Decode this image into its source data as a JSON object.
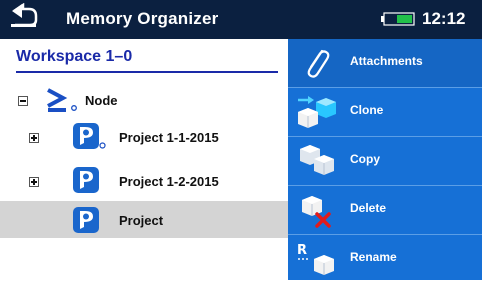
{
  "header": {
    "title": "Memory Organizer",
    "time": "12:12",
    "back_icon": "return-arrow-icon",
    "battery_icon": "battery-icon",
    "colors": {
      "bar": "#0b2040",
      "battery_fill": "#22c04a"
    }
  },
  "tree": {
    "workspace_label": "Workspace 1–0",
    "items": [
      {
        "label": "Node",
        "icon": "node-icon",
        "expander": "collapse"
      },
      {
        "label": "Project 1-1-2015",
        "icon": "project-icon",
        "expander": "expand"
      },
      {
        "label": "Project 1-2-2015",
        "icon": "project-icon",
        "expander": "expand"
      },
      {
        "label": "Project",
        "icon": "project-icon",
        "selected": true
      }
    ]
  },
  "actions": [
    {
      "label": "Attachments",
      "icon": "paperclip-icon"
    },
    {
      "label": "Clone",
      "icon": "clone-icon"
    },
    {
      "label": "Copy",
      "icon": "copy-icon"
    },
    {
      "label": "Delete",
      "icon": "delete-icon"
    },
    {
      "label": "Rename",
      "icon": "rename-icon"
    }
  ],
  "colors": {
    "panel": "#1670d6",
    "selected_row": "#d4d4d4",
    "workspace_text": "#1a2aa8",
    "project_icon": "#1a66cc"
  }
}
